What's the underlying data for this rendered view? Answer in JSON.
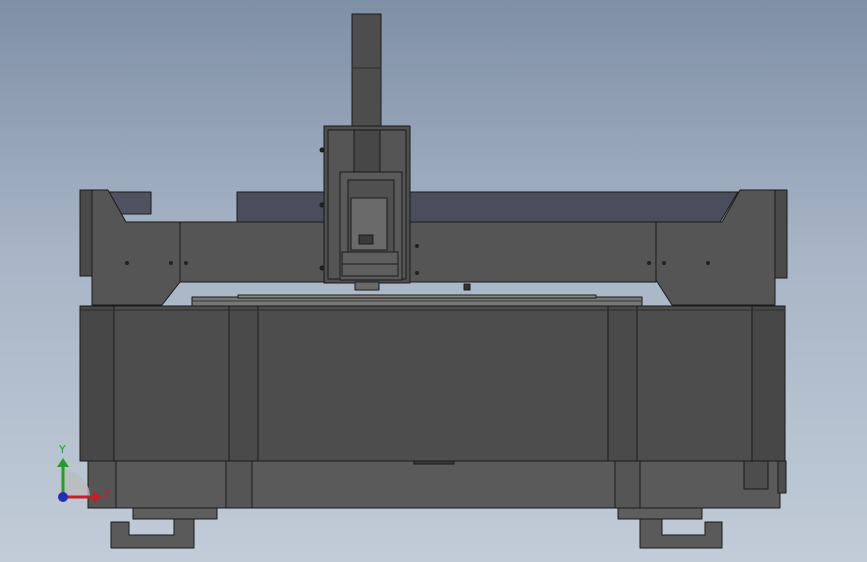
{
  "viewport": {
    "kind": "3D CAD model view",
    "model": "cnc-gantry-machine-front-view",
    "colors": {
      "background_top": "#7f8fa6",
      "background_bottom": "#c2ccd8",
      "body": "#4d4d4d",
      "body_light": "#5a5a5a",
      "edge": "#1a1a1a",
      "beam_top": "#4a4e5c"
    }
  },
  "triad": {
    "x_label": "X",
    "y_label": "Y",
    "x_color": "#c0202a",
    "y_color": "#2a9a2a",
    "origin_color": "#2030b0"
  }
}
